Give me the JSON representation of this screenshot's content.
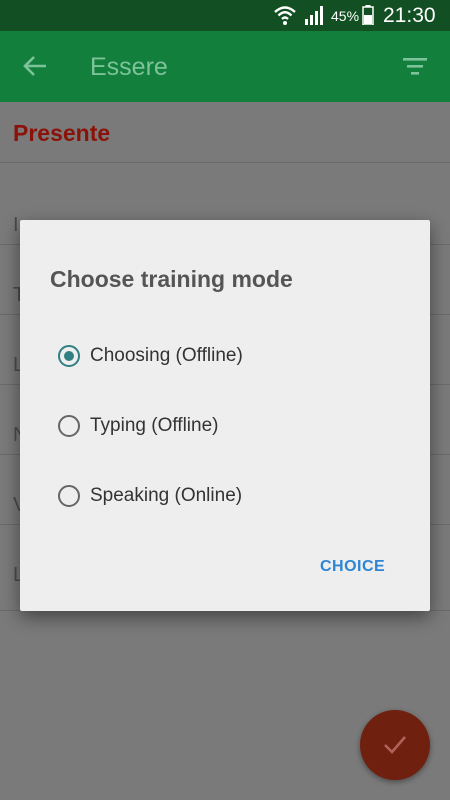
{
  "status_bar": {
    "battery_percent": "45%",
    "time": "21:30"
  },
  "toolbar": {
    "title": "Essere",
    "back_icon": "arrow-left-icon",
    "filter_icon": "filter-icon"
  },
  "section": {
    "header": "Presente"
  },
  "background_rows": [
    "I",
    "T",
    "L",
    "N",
    "V",
    "L"
  ],
  "dialog": {
    "title": "Choose training mode",
    "options": [
      {
        "label": "Choosing (Offline)",
        "selected": true
      },
      {
        "label": "Typing (Offline)",
        "selected": false
      },
      {
        "label": "Speaking (Online)",
        "selected": false
      }
    ],
    "action_label": "CHOICE"
  },
  "colors": {
    "toolbar": "#137f3c",
    "status_bar": "#124f22",
    "accent": "#2f7f83",
    "header_red": "#c62828",
    "action_blue": "#2b86d6"
  }
}
